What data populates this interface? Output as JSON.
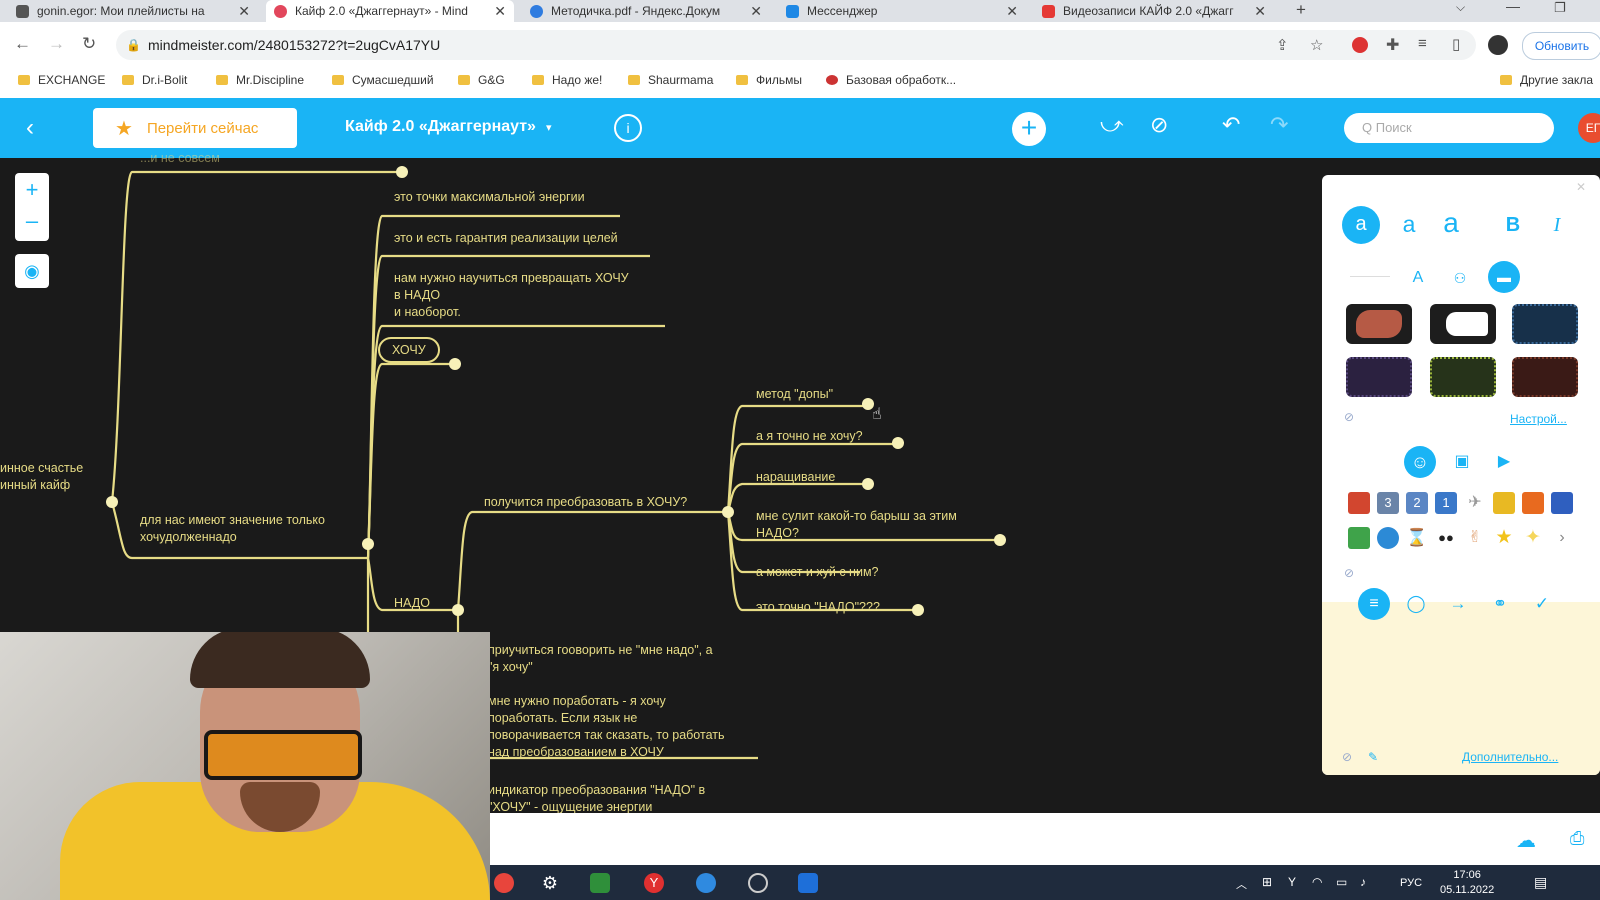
{
  "tabs": [
    {
      "title": "gonin.egor: Мои плейлисты на",
      "color": "#555"
    },
    {
      "title": "Кайф 2.0 «Джаггернаут» - Mind",
      "color": "#e2475c",
      "active": true
    },
    {
      "title": "Методичка.pdf - Яндекс.Докум",
      "color": "#2f7ce0"
    },
    {
      "title": "Мессенджер",
      "color": "#1e88e5"
    },
    {
      "title": "Видеозаписи КАЙФ 2.0 «Джагг",
      "color": "#e53935"
    }
  ],
  "address": {
    "url": "mindmeister.com/2480153272?t=2ugCvA17YU",
    "update_label": "Обновить"
  },
  "bookmarks": [
    "EXCHANGE",
    "Dr.i-Bolit",
    "Mr.Discipline",
    "Сумасшедший",
    "G&G",
    "Надо же!",
    "Shaurmama",
    "Фильмы",
    "Базовая обработк...",
    "Другие закла"
  ],
  "toolbar": {
    "go_now": "Перейти сейчас",
    "map_title": "Кайф 2.0 «Джаггернаут»",
    "search_placeholder": "Q  Поиск",
    "avatar": "ЕГ"
  },
  "mindmap": {
    "top_cut": "...и не совсем",
    "n1": "это точки максимальной энергии",
    "n2": "это и есть гарантия реализации целей",
    "n3a": "нам нужно научиться превращать ХОЧУ",
    "n3b": "в НАДО",
    "n3c": "и наоборот.",
    "hochu": "ХОЧУ",
    "left_a": "инное счастье",
    "left_b": "инный кайф",
    "mid_a": "для нас имеют значение только",
    "mid_b": "хочудолженнадо",
    "nado": "НАДО",
    "convert": "получится преобразовать в ХОЧУ?",
    "r1": "метод \"допы\"",
    "r2": "а я точно не хочу?",
    "r3": "наращивание",
    "r4a": "мне сулит какой-то барыш за этим",
    "r4b": "НАДО?",
    "r5": "а может и хуй с ним?",
    "r6": "это точно \"НАДО\"???",
    "b1a": "приучиться гооворить не \"мне надо\", а",
    "b1b": "\"я хочу\"",
    "b2a": "мне нужно поработать - я хочу",
    "b2b": "поработать. Если язык не",
    "b2c": "поворачивается так сказать, то работать",
    "b2d": "над преобразованием в ХОЧУ",
    "b3a": "индикатор преобразования \"НАДО\" в",
    "b3b": "\"ХОЧУ\" - ощущение энергии"
  },
  "panel": {
    "font_a": "a",
    "bold": "B",
    "italic": "I",
    "customize": "Настрой...",
    "more": "Дополнительно..."
  },
  "taskbar": {
    "time": "17:06",
    "date": "05.11.2022",
    "lang": "РУС"
  }
}
